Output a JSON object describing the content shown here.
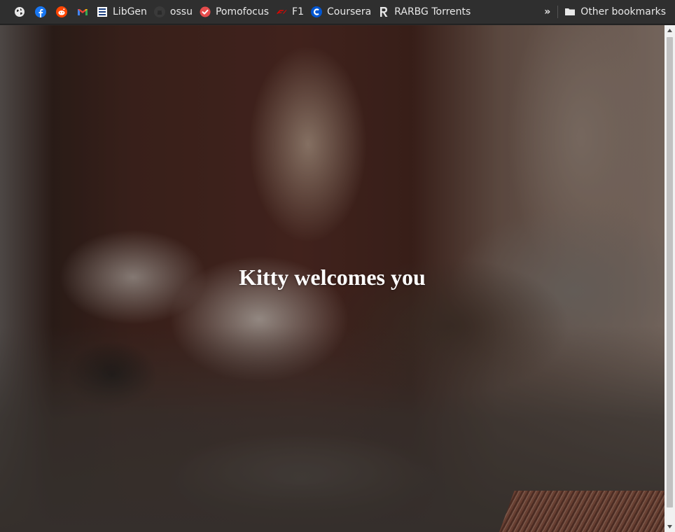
{
  "bookmarks_bar": {
    "items": [
      {
        "label": "",
        "icon": "globe-icon"
      },
      {
        "label": "",
        "icon": "facebook-icon",
        "color": "#1877f2"
      },
      {
        "label": "",
        "icon": "reddit-icon",
        "color": "#ff4500"
      },
      {
        "label": "",
        "icon": "gmail-icon"
      },
      {
        "label": "LibGen",
        "icon": "libgen-icon"
      },
      {
        "label": "ossu",
        "icon": "github-icon"
      },
      {
        "label": "Pomofocus",
        "icon": "pomofocus-icon",
        "color": "#e74c4c"
      },
      {
        "label": "F1",
        "icon": "f1-icon",
        "color": "#e10600"
      },
      {
        "label": "Coursera",
        "icon": "coursera-icon",
        "color": "#0056d2"
      },
      {
        "label": "RARBG Torrents",
        "icon": "rarbg-icon"
      }
    ],
    "overflow_glyph": "»",
    "other_bookmarks": {
      "label": "Other bookmarks",
      "icon": "folder-icon"
    }
  },
  "page": {
    "title": "Kitty welcomes you",
    "background": "sleeping-tabby-kitten-photo"
  }
}
